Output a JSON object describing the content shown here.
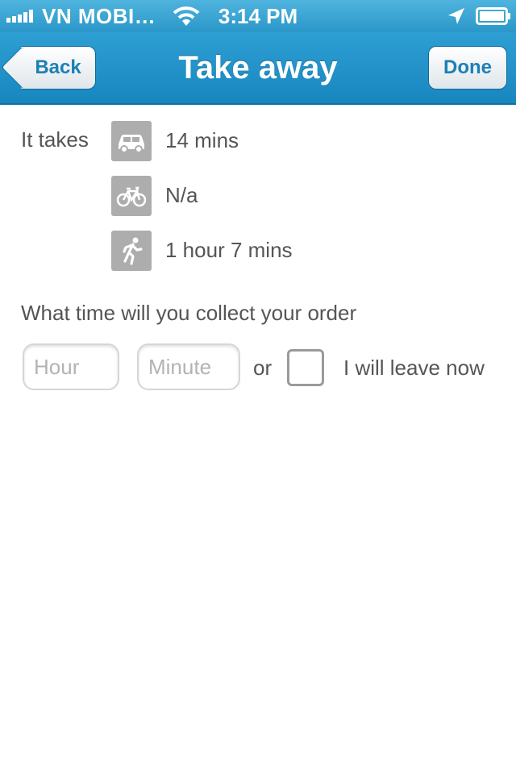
{
  "status_bar": {
    "carrier": "VN MOBI…",
    "time": "3:14 PM"
  },
  "nav": {
    "title": "Take away",
    "back_label": "Back",
    "done_label": "Done"
  },
  "travel": {
    "label": "It takes",
    "options": [
      {
        "mode": "car",
        "icon": "car-icon",
        "value": "14 mins"
      },
      {
        "mode": "bike",
        "icon": "bicycle-icon",
        "value": "N/a"
      },
      {
        "mode": "walk",
        "icon": "walking-icon",
        "value": "1 hour 7 mins"
      }
    ]
  },
  "collect": {
    "question": "What time will you collect your order",
    "hour_placeholder": "Hour",
    "minute_placeholder": "Minute",
    "or_label": "or",
    "leave_now_label": "I will leave now",
    "leave_now_checked": false
  },
  "colors": {
    "bar_blue": "#2a97c9",
    "icon_gray": "#adadad",
    "text_gray": "#555555"
  }
}
